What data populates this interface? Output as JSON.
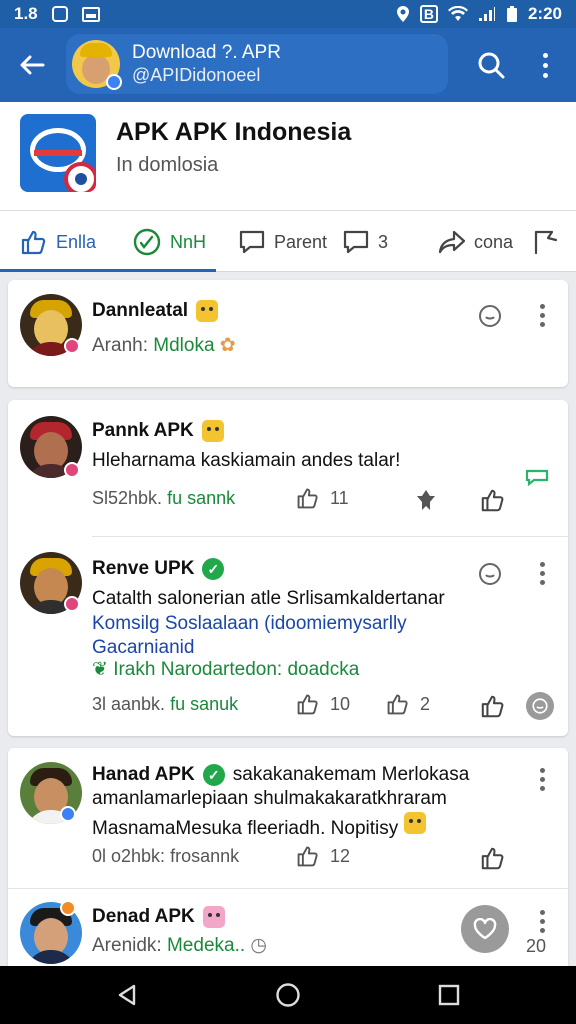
{
  "status_bar": {
    "left_text": "1.8",
    "time": "2:20",
    "status_mark": "B",
    "icons": [
      "notification-icon",
      "image-icon",
      "location-icon",
      "wifi-icon",
      "signal-icon",
      "battery-icon"
    ]
  },
  "header": {
    "title": "Download ?. APR",
    "subtitle": "@APIDidonoeel"
  },
  "group": {
    "title": "APK APK Indonesia",
    "subtitle": "In domlosia"
  },
  "tabs": [
    {
      "label": "Enlla"
    },
    {
      "label": "NnH"
    },
    {
      "label": "Parent"
    },
    {
      "label": "3"
    },
    {
      "label": "cona"
    }
  ],
  "posts": [
    {
      "name": "Dannleatal",
      "line1_prefix": "Aranh:",
      "line1_value": "Mdloka"
    },
    {
      "name": "Pannk APK",
      "text": "Hleharnama kaskiamain andes talar!",
      "meta_time": "Sl52hbk.",
      "meta_tag": "fu sannk",
      "likes": "11"
    },
    {
      "name": "Renve UPK",
      "text": "Catalth salonerian atle Srlisamkaldertanar",
      "link_line1": "Komsilg Soslaalaan (idoomiemysarlly",
      "link_line2": "Gacarnianid",
      "green_line": "Irakh Narodartedon: doadcka",
      "meta_time": "3l aanbk.",
      "meta_tag": "fu sanuk",
      "likes": "10",
      "shares": "2"
    },
    {
      "name": "Hanad APK",
      "name_tail": "sakakanakemam Merlokasa",
      "line2": "amanlamarlepiaan shulmakakaratkhraram",
      "line3": "MasnamaMesuka fleeriadh. Nopitisy",
      "meta_time": "0l o2hbk:",
      "meta_tag": "frosannk",
      "likes": "12"
    },
    {
      "name": "Denad APK",
      "line1_prefix": "Arenidk:",
      "line1_value": "Medeka..",
      "count": "20"
    }
  ]
}
